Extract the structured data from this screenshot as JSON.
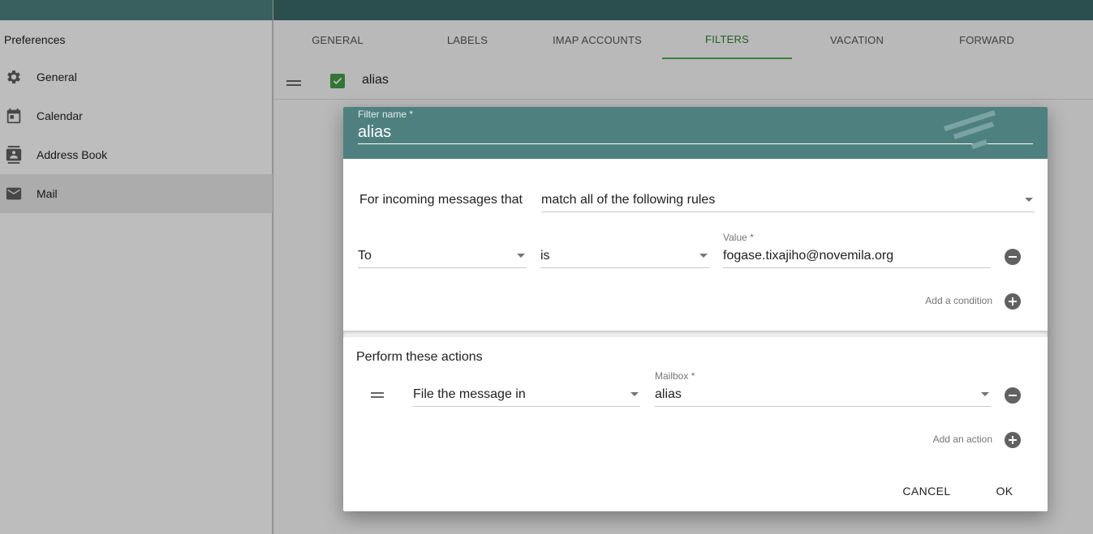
{
  "sidebar": {
    "title": "Preferences",
    "items": [
      {
        "label": "General",
        "icon": "gear-icon"
      },
      {
        "label": "Calendar",
        "icon": "calendar-icon"
      },
      {
        "label": "Address Book",
        "icon": "address-book-icon"
      },
      {
        "label": "Mail",
        "icon": "mail-icon"
      }
    ]
  },
  "tabs": [
    "GENERAL",
    "LABELS",
    "IMAP ACCOUNTS",
    "FILTERS",
    "VACATION",
    "FORWARD"
  ],
  "active_tab": "FILTERS",
  "filter_list": {
    "name": "alias",
    "enabled": true
  },
  "dialog": {
    "filter_name_label": "Filter name",
    "filter_name_value": "alias",
    "rules": {
      "intro": "For incoming messages that",
      "match_mode": "match all of the following rules",
      "condition": {
        "field": "To",
        "operator": "is",
        "value_label": "Value",
        "value": "fogase.tixajiho@novemila.org"
      },
      "add_condition": "Add a condition"
    },
    "actions": {
      "title": "Perform these actions",
      "action": {
        "type": "File the message in",
        "mailbox_label": "Mailbox",
        "mailbox": "alias"
      },
      "add_action": "Add an action"
    },
    "buttons": {
      "cancel": "CANCEL",
      "ok": "OK"
    }
  },
  "colors": {
    "header": "#4f8080",
    "accent": "#4caf50"
  }
}
